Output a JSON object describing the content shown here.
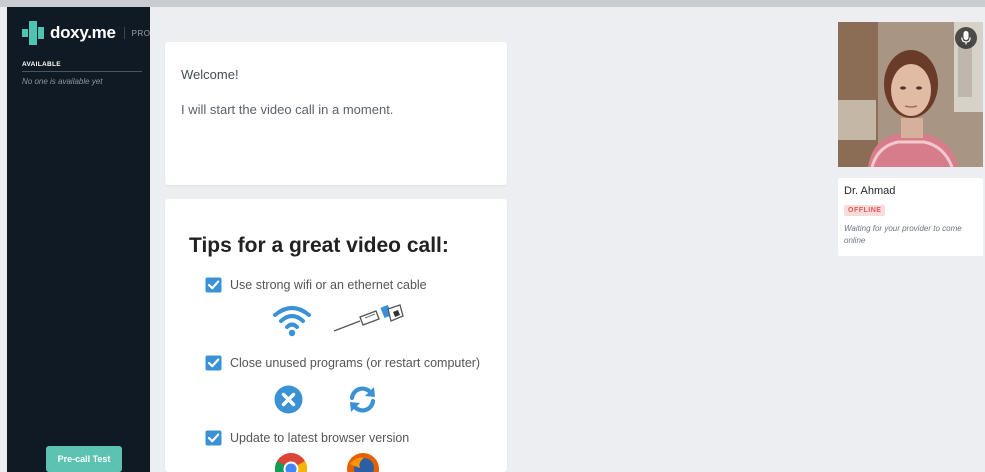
{
  "app": {
    "brand": "doxy.me",
    "plan": "PRO"
  },
  "sidebar": {
    "available_heading": "AVAILABLE",
    "available_empty": "No one is available yet",
    "precall_button": "Pre-call Test"
  },
  "welcome": {
    "title": "Welcome!",
    "message": "I will start the video call in a moment."
  },
  "tips": {
    "title": "Tips for a great video call:",
    "items": [
      {
        "text": "Use strong wifi or an ethernet cable",
        "icons": [
          "wifi-icon",
          "ethernet-cable-icon"
        ]
      },
      {
        "text": "Close unused programs (or restart computer)",
        "icons": [
          "close-circle-icon",
          "refresh-icon"
        ]
      },
      {
        "text": "Update to latest browser version",
        "icons": [
          "chrome-icon",
          "firefox-icon"
        ]
      }
    ]
  },
  "provider": {
    "name": "Dr. Ahmad",
    "status": "OFFLINE",
    "status_message": "Waiting for your provider to come online"
  },
  "colors": {
    "accent": "#3b91d6",
    "teal": "#5cc3b3",
    "sidebar_bg": "#0f1a24",
    "offline_bg": "#fbdada",
    "offline_text": "#e05a5a"
  }
}
